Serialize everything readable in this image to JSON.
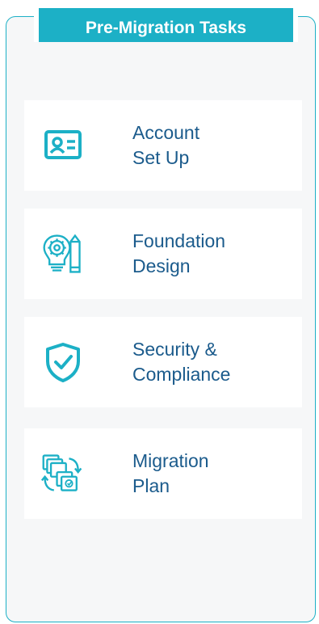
{
  "title": "Pre-Migration Tasks",
  "colors": {
    "accent": "#1cb0c6",
    "text": "#1b5b8c",
    "panel": "#f6f7f8",
    "card": "#ffffff"
  },
  "tasks": [
    {
      "icon": "id-card-icon",
      "line1": "Account",
      "line2": "Set Up"
    },
    {
      "icon": "lightbulb-gear-pencil-icon",
      "line1": "Foundation",
      "line2": "Design"
    },
    {
      "icon": "shield-check-icon",
      "line1": "Security &",
      "line2": "Compliance"
    },
    {
      "icon": "migration-documents-icon",
      "line1": "Migration",
      "line2": "Plan"
    }
  ]
}
